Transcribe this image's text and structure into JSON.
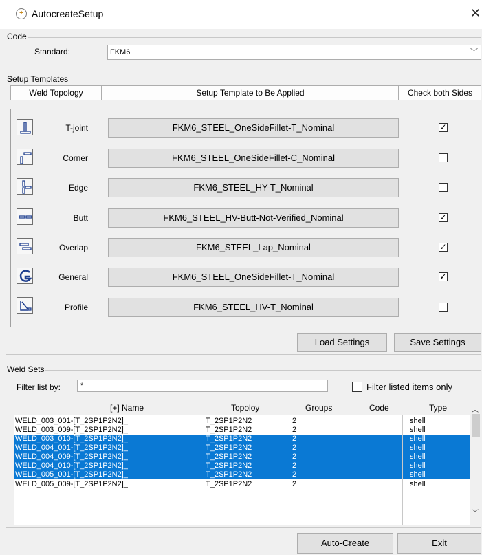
{
  "window": {
    "title": "AutocreateSetup",
    "close_glyph": "✕"
  },
  "code": {
    "group_label": "Code",
    "standard_label": "Standard:",
    "standard_value": "FKM6"
  },
  "setup": {
    "group_label": "Setup Templates",
    "headers": {
      "topology": "Weld Topology",
      "template": "Setup Template to Be Applied",
      "check": "Check both Sides"
    },
    "rows": [
      {
        "icon": "t-joint-icon",
        "label": "T-joint",
        "template": "FKM6_STEEL_OneSideFillet-T_Nominal",
        "checked": true
      },
      {
        "icon": "corner-joint-icon",
        "label": "Corner",
        "template": "FKM6_STEEL_OneSideFillet-C_Nominal",
        "checked": false
      },
      {
        "icon": "edge-joint-icon",
        "label": "Edge",
        "template": "FKM6_STEEL_HY-T_Nominal",
        "checked": false
      },
      {
        "icon": "butt-joint-icon",
        "label": "Butt",
        "template": "FKM6_STEEL_HV-Butt-Not-Verified_Nominal",
        "checked": true
      },
      {
        "icon": "overlap-joint-icon",
        "label": "Overlap",
        "template": "FKM6_STEEL_Lap_Nominal",
        "checked": true
      },
      {
        "icon": "general-joint-icon",
        "label": "General",
        "template": "FKM6_STEEL_OneSideFillet-T_Nominal",
        "checked": true
      },
      {
        "icon": "profile-joint-icon",
        "label": "Profile",
        "template": "FKM6_STEEL_HV-T_Nominal",
        "checked": false
      }
    ],
    "load_label": "Load Settings",
    "save_label": "Save Settings"
  },
  "weld_sets": {
    "group_label": "Weld Sets",
    "filter_label": "Filter list by:",
    "filter_value": "*",
    "filter_only_label": "Filter listed items only",
    "columns": [
      "[+] Name",
      "Topoloy",
      "Groups",
      "Code",
      "Type"
    ],
    "rows": [
      {
        "name": "WELD_003_001-[T_2SP1P2N2]_",
        "topology": "T_2SP1P2N2",
        "groups": "2",
        "code": "",
        "type": "shell",
        "selected": false
      },
      {
        "name": "WELD_003_009-[T_2SP1P2N2]_",
        "topology": "T_2SP1P2N2",
        "groups": "2",
        "code": "",
        "type": "shell",
        "selected": false
      },
      {
        "name": "WELD_003_010-[T_2SP1P2N2]_",
        "topology": "T_2SP1P2N2",
        "groups": "2",
        "code": "",
        "type": "shell",
        "selected": true
      },
      {
        "name": "WELD_004_001-[T_2SP1P2N2]_",
        "topology": "T_2SP1P2N2",
        "groups": "2",
        "code": "",
        "type": "shell",
        "selected": true
      },
      {
        "name": "WELD_004_009-[T_2SP1P2N2]_",
        "topology": "T_2SP1P2N2",
        "groups": "2",
        "code": "",
        "type": "shell",
        "selected": true
      },
      {
        "name": "WELD_004_010-[T_2SP1P2N2]_",
        "topology": "T_2SP1P2N2",
        "groups": "2",
        "code": "",
        "type": "shell",
        "selected": true
      },
      {
        "name": "WELD_005_001-[T_2SP1P2N2]_",
        "topology": "T_2SP1P2N2",
        "groups": "2",
        "code": "",
        "type": "shell",
        "selected": true
      },
      {
        "name": "WELD_005_009-[T_2SP1P2N2]_",
        "topology": "T_2SP1P2N2",
        "groups": "2",
        "code": "",
        "type": "shell",
        "selected": false
      }
    ]
  },
  "footer": {
    "auto_create_label": "Auto-Create",
    "exit_label": "Exit"
  },
  "colors": {
    "selection": "#0a79d4"
  }
}
